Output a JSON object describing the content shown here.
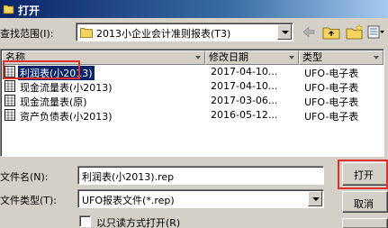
{
  "window": {
    "title": "打开"
  },
  "look_in": {
    "label": "查找范围(I):",
    "value": "2013小企业会计准则报表(T3)"
  },
  "columns": {
    "name": "名称",
    "modified": "修改日期",
    "type": "类型"
  },
  "files": [
    {
      "name": "利润表(小2013)",
      "modified": "2017-04-10...",
      "type": "UFO-电子表",
      "selected": true
    },
    {
      "name": "现金流量表(小2013)",
      "modified": "2017-04-10...",
      "type": "UFO-电子表",
      "selected": false
    },
    {
      "name": "现金流量表(原)",
      "modified": "2017-03-06...",
      "type": "UFO-电子表",
      "selected": false
    },
    {
      "name": "资产负债表(小2013)",
      "modified": "2016-05-12...",
      "type": "UFO-电子表",
      "selected": false
    }
  ],
  "file_name": {
    "label": "文件名(N):",
    "value": "利润表(小2013).rep"
  },
  "file_type": {
    "label": "文件类型(T):",
    "value": "UFO报表文件(*.rep)"
  },
  "read_only": {
    "label": "以只读方式打开(R)",
    "checked": false
  },
  "buttons": {
    "open": "打开",
    "cancel": "取消"
  },
  "icons": {
    "back": "back-arrow-icon",
    "up": "up-folder-icon",
    "new_folder": "new-folder-icon",
    "folder": "folder-icon",
    "file": "spreadsheet-file-icon"
  },
  "colors": {
    "selection": "#0a246a",
    "highlight": "#e0302c",
    "titlebar": "#0a246a"
  }
}
